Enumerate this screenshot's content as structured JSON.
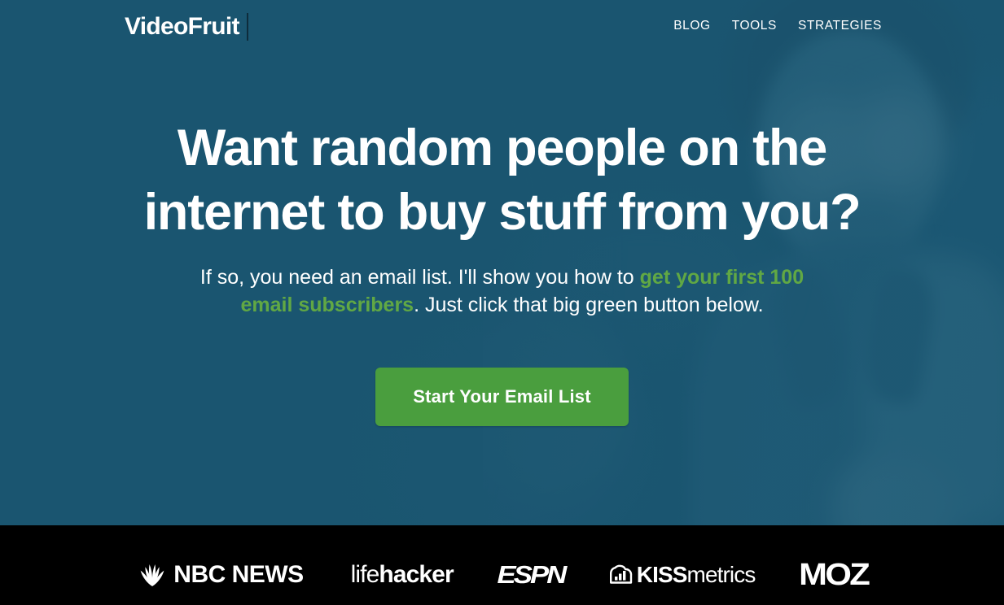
{
  "colors": {
    "hero_bg": "#1a5570",
    "accent_green": "#61a844",
    "button_green": "#4a9e3e",
    "logobar_bg": "#000000",
    "text_white": "#ffffff"
  },
  "header": {
    "logo_text": "VideoFruit",
    "nav": [
      {
        "label": "BLOG"
      },
      {
        "label": "TOOLS"
      },
      {
        "label": "STRATEGIES"
      }
    ]
  },
  "hero": {
    "headline": "Want random people on the internet to buy stuff from you?",
    "subhead_part1": "If so, you need an email list. I'll show you how to ",
    "subhead_highlight": "get your first 100 email subscribers",
    "subhead_part2": ". Just click that big green button below.",
    "cta_label": "Start Your Email List"
  },
  "logobar": {
    "brands": [
      {
        "name": "NBC NEWS",
        "icon": "nbc-peacock-icon",
        "text": "NBC NEWS"
      },
      {
        "name": "lifehacker",
        "text_thin": "life",
        "text_bold": "hacker"
      },
      {
        "name": "ESPN",
        "text": "ESPN"
      },
      {
        "name": "KISSmetrics",
        "icon": "kissmetrics-cloud-chart-icon",
        "text_bold": "KISS",
        "text_normal": "metrics"
      },
      {
        "name": "MOZ",
        "text": "MOZ"
      }
    ]
  }
}
